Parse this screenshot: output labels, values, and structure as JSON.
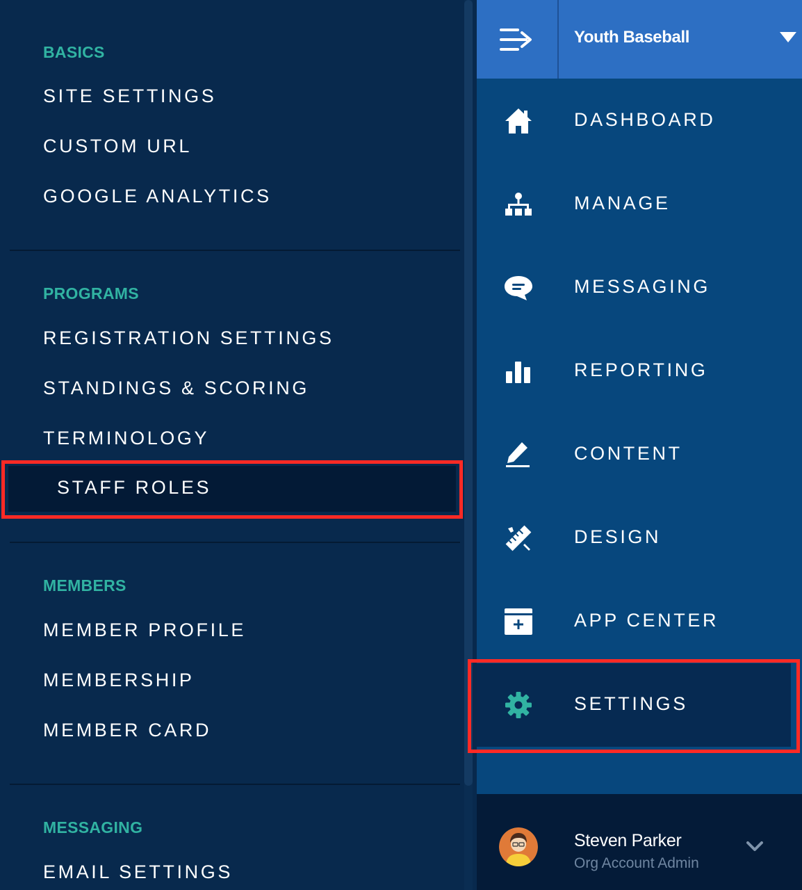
{
  "settings_menu": {
    "sections": {
      "basics": {
        "heading": "BASICS",
        "items": [
          "SITE SETTINGS",
          "CUSTOM URL",
          "GOOGLE ANALYTICS"
        ]
      },
      "programs": {
        "heading": "PROGRAMS",
        "items": [
          "REGISTRATION SETTINGS",
          "STANDINGS & SCORING",
          "TERMINOLOGY",
          "STAFF ROLES"
        ]
      },
      "members": {
        "heading": "MEMBERS",
        "items": [
          "MEMBER PROFILE",
          "MEMBERSHIP",
          "MEMBER CARD"
        ]
      },
      "messaging": {
        "heading": "MESSAGING",
        "items": [
          "EMAIL SETTINGS"
        ]
      }
    },
    "selected_item": "STAFF ROLES"
  },
  "nav": {
    "org_name": "Youth Baseball",
    "items": [
      {
        "label": "DASHBOARD",
        "icon": "home-icon"
      },
      {
        "label": "MANAGE",
        "icon": "org-chart-icon"
      },
      {
        "label": "MESSAGING",
        "icon": "chat-bubble-icon"
      },
      {
        "label": "REPORTING",
        "icon": "bar-chart-icon"
      },
      {
        "label": "CONTENT",
        "icon": "pencil-icon"
      },
      {
        "label": "DESIGN",
        "icon": "ruler-pencil-icon"
      },
      {
        "label": "APP CENTER",
        "icon": "app-add-icon"
      },
      {
        "label": "SETTINGS",
        "icon": "gear-icon"
      }
    ],
    "active_item": "SETTINGS"
  },
  "user": {
    "name": "Steven Parker",
    "role": "Org Account Admin"
  },
  "colors": {
    "panel_bg": "#08294d",
    "nav_bg": "#07477d",
    "topbar_bg": "#2d6fc3",
    "section_heading": "#31b3a2",
    "highlight": "#ff2a25",
    "gear_accent": "#31b3a2"
  }
}
